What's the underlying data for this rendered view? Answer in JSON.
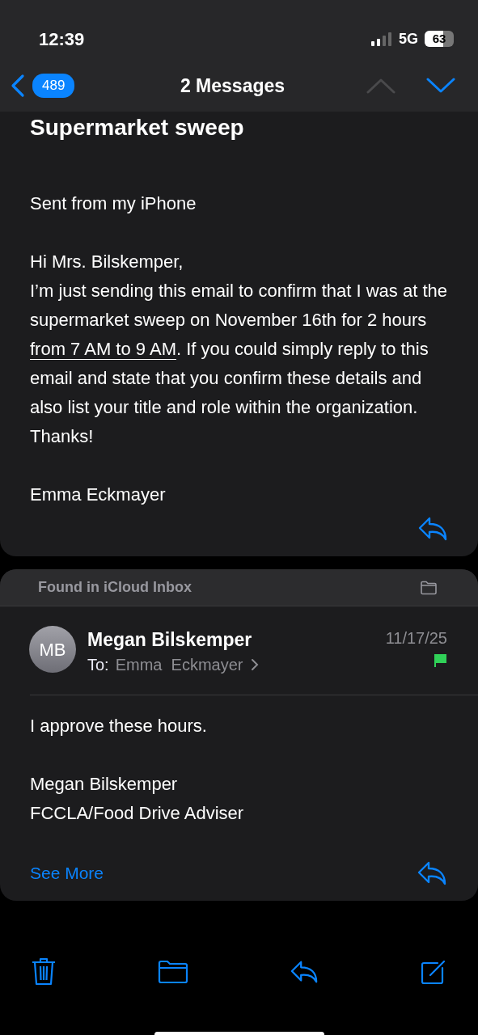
{
  "status_bar": {
    "time": "12:39",
    "network": "5G",
    "battery": "63"
  },
  "nav": {
    "back_count": "489",
    "title": "2 Messages",
    "prev": {
      "disabled": true
    },
    "next": {
      "disabled": false
    }
  },
  "message_1": {
    "subject": "Supermarket sweep",
    "paragraphs": [
      [
        {
          "kind": "plain",
          "text": "Sent from my iPhone"
        }
      ],
      [
        {
          "kind": "plain",
          "text": "Hi Mrs. Bilskemper,"
        },
        {
          "kind": "linked",
          "before": "I’m just sending this email to confirm that I was at the supermarket sweep on November 16th for 2 hours ",
          "link": "from 7 AM to 9 AM",
          "after": ". If you could simply reply to this email and state that you confirm these details and also list your title and role within the organization. Thanks!"
        }
      ],
      [
        {
          "kind": "plain",
          "text": "Emma Eckmayer"
        }
      ]
    ]
  },
  "message_2": {
    "found_in": "Found in iCloud Inbox",
    "initials": "MB",
    "sender": "Megan Bilskemper",
    "to_label": "To:",
    "recipient": "Emma  Eckmayer",
    "date": "11/17/25",
    "flagged": true,
    "paragraphs": [
      [
        {
          "kind": "plain",
          "text": "I approve these hours."
        }
      ],
      [
        {
          "kind": "plain",
          "text": "Megan Bilskemper"
        },
        {
          "kind": "plain",
          "text": "FCCLA/Food Drive Adviser"
        }
      ]
    ],
    "see_more": "See More"
  }
}
